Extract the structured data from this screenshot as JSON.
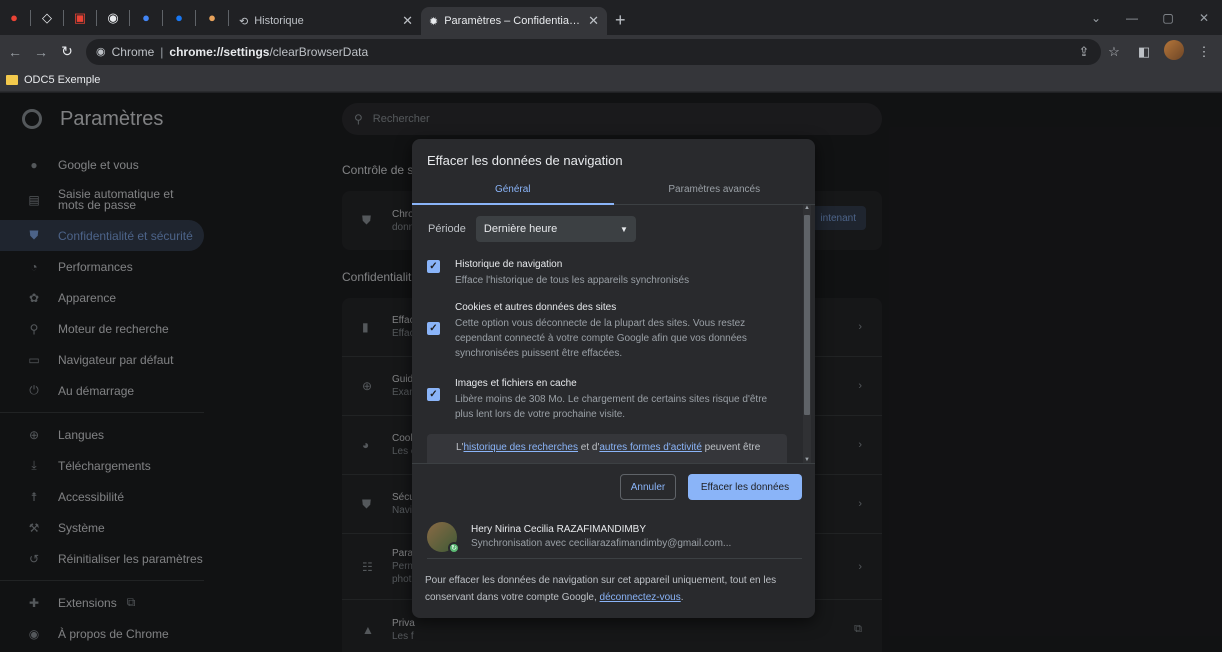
{
  "browser": {
    "tabs": [
      {
        "label": "Historique",
        "icon": "history-icon",
        "active": false
      },
      {
        "label": "Paramètres – Confidentialité et sécurité",
        "icon": "gear-icon",
        "active": true
      }
    ],
    "url_origin": "Chrome",
    "url_path_bold": "chrome://settings",
    "url_path_rest": "/clearBrowserData",
    "bookmark": "ODC5 Exemple"
  },
  "settings": {
    "title": "Paramètres",
    "search_placeholder": "Rechercher",
    "nav": [
      {
        "label": "Google et vous",
        "icon": "person-icon"
      },
      {
        "label": "Saisie automatique et mots de passe",
        "icon": "clipboard-icon"
      },
      {
        "label": "Confidentialité et sécurité",
        "icon": "shield-icon",
        "active": true
      },
      {
        "label": "Performances",
        "icon": "speedometer-icon"
      },
      {
        "label": "Apparence",
        "icon": "palette-icon"
      },
      {
        "label": "Moteur de recherche",
        "icon": "search-icon"
      },
      {
        "label": "Navigateur par défaut",
        "icon": "browser-icon"
      },
      {
        "label": "Au démarrage",
        "icon": "power-icon"
      },
      {
        "label": "Langues",
        "icon": "globe-icon"
      },
      {
        "label": "Téléchargements",
        "icon": "download-icon"
      },
      {
        "label": "Accessibilité",
        "icon": "accessibility-icon"
      },
      {
        "label": "Système",
        "icon": "wrench-icon"
      },
      {
        "label": "Réinitialiser les paramètres",
        "icon": "reset-icon"
      },
      {
        "label": "Extensions",
        "icon": "puzzle-icon"
      },
      {
        "label": "À propos de Chrome",
        "icon": "chrome-icon"
      }
    ],
    "section_safety": "Contrôle de s",
    "safety_row": {
      "line1": "Chro",
      "line2": "donn",
      "button": "intenant"
    },
    "section_privacy": "Confidentialit",
    "privacy_rows": [
      {
        "line1": "Effac",
        "line2": "Effac"
      },
      {
        "line1": "Guid",
        "line2": "Exam"
      },
      {
        "line1": "Cook",
        "line2": "Les c"
      },
      {
        "line1": "Sécu",
        "line2": "Navi"
      },
      {
        "line1": "Para",
        "line2": "Perm",
        "line3": "phot"
      },
      {
        "line1": "Priva",
        "line2": "Les f"
      }
    ]
  },
  "dialog": {
    "title": "Effacer les données de navigation",
    "tab_basic": "Général",
    "tab_advanced": "Paramètres avancés",
    "period_label": "Période",
    "period_value": "Dernière heure",
    "items": [
      {
        "title": "Historique de navigation",
        "desc": "Efface l'historique de tous les appareils synchronisés",
        "checked": true
      },
      {
        "title": "Cookies et autres données des sites",
        "desc": "Cette option vous déconnecte de la plupart des sites. Vous restez cependant connecté à votre compte Google afin que vos données synchronisées puissent être effacées.",
        "checked": true
      },
      {
        "title": "Images et fichiers en cache",
        "desc": "Libère moins de 308 Mo. Le chargement de certains sites risque d'être plus lent lors de votre prochaine visite.",
        "checked": true
      }
    ],
    "notice_pre": "L'",
    "notice_link1": "historique des recherches",
    "notice_mid": " et d'",
    "notice_link2": "autres formes d'activité",
    "notice_post": " peuvent être",
    "cancel": "Annuler",
    "confirm": "Effacer les données",
    "account_name": "Hery Nirina Cecilia RAZAFIMANDIMBY",
    "account_sync": "Synchronisation avec ceciliarazafimandimby@gmail.com...",
    "footer_text": "Pour effacer les données de navigation sur cet appareil uniquement, tout en les conservant dans votre compte Google, ",
    "footer_link": "déconnectez-vous",
    "footer_end": "."
  },
  "colors": {
    "accent": "#8ab4f8",
    "background": "#202124",
    "surface": "#292a2d"
  }
}
